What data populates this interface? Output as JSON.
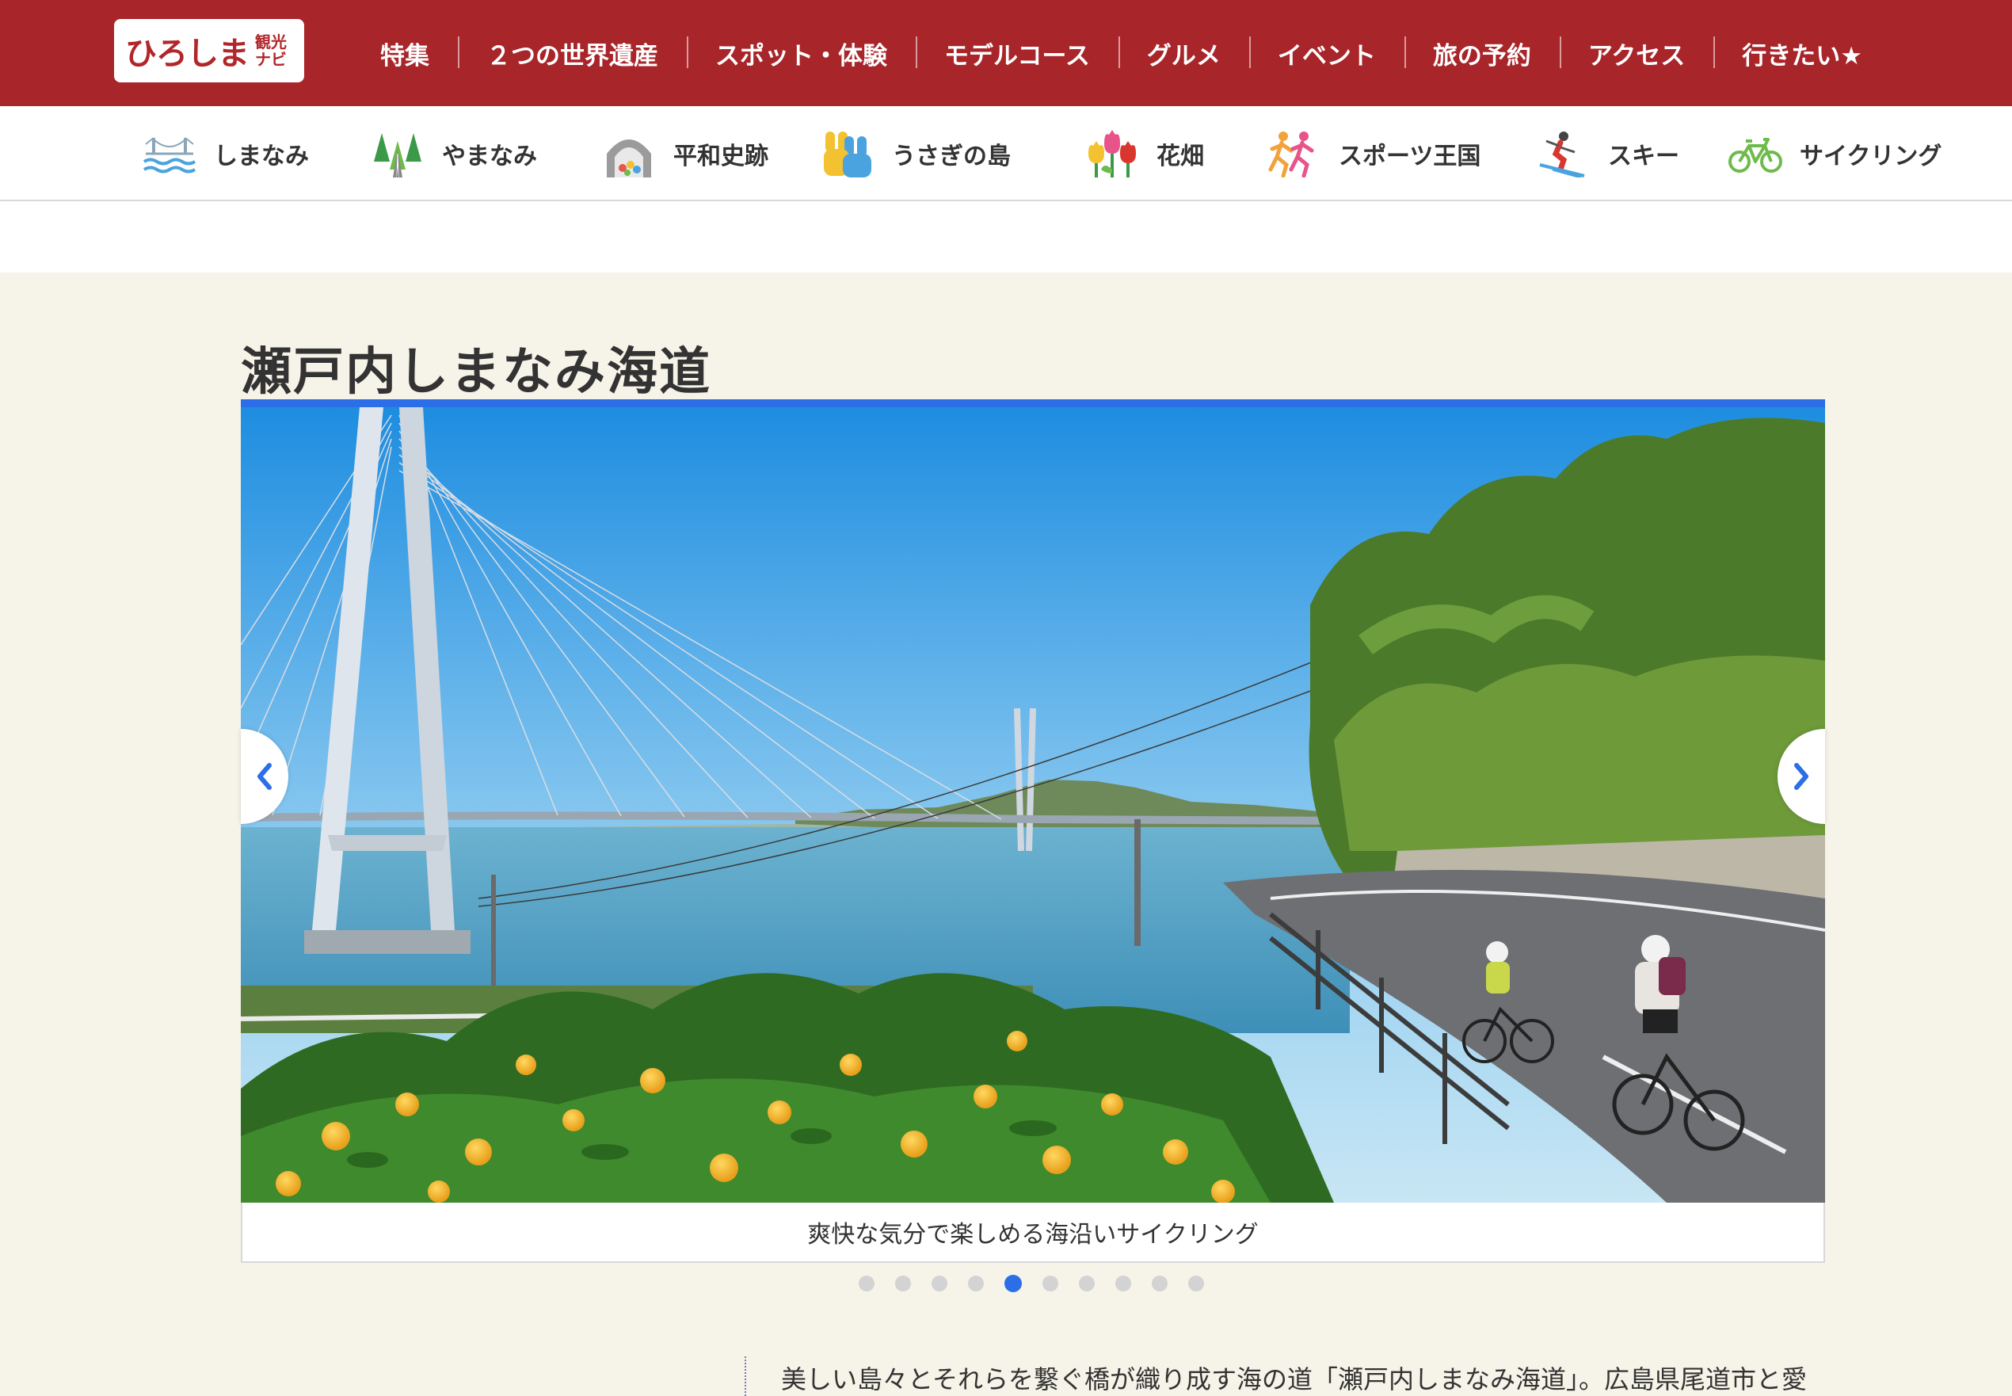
{
  "header": {
    "logo_main": "ひろしま",
    "logo_sub_1": "観光",
    "logo_sub_2": "ナビ",
    "nav": [
      "特集",
      "２つの世界遺産",
      "スポット・体験",
      "モデルコース",
      "グルメ",
      "イベント",
      "旅の予約",
      "アクセス",
      "行きたい★"
    ]
  },
  "categories": [
    {
      "label": "しまなみ",
      "icon": "bridge-icon"
    },
    {
      "label": "やまなみ",
      "icon": "trees-icon"
    },
    {
      "label": "平和史跡",
      "icon": "peace-dome-icon"
    },
    {
      "label": "うさぎの島",
      "icon": "rabbit-icon"
    },
    {
      "label": "花畑",
      "icon": "tulip-icon"
    },
    {
      "label": "スポーツ王国",
      "icon": "runners-icon"
    },
    {
      "label": "スキー",
      "icon": "skier-icon"
    },
    {
      "label": "サイクリング",
      "icon": "bicycle-icon"
    }
  ],
  "section": {
    "title": "瀬戸内しまなみ海道"
  },
  "slider": {
    "caption": "爽快な気分で楽しめる海沿いサイクリング",
    "slide_count": 10,
    "active_index": 4
  },
  "body": {
    "text": "美しい島々とそれらを繋ぐ橋が織り成す海の道「瀬戸内しまなみ海道」。広島県尾道市と愛"
  },
  "colors": {
    "brand_red": "#a8252a",
    "accent_blue": "#2c6ee8",
    "background": "#f6f3e8"
  }
}
